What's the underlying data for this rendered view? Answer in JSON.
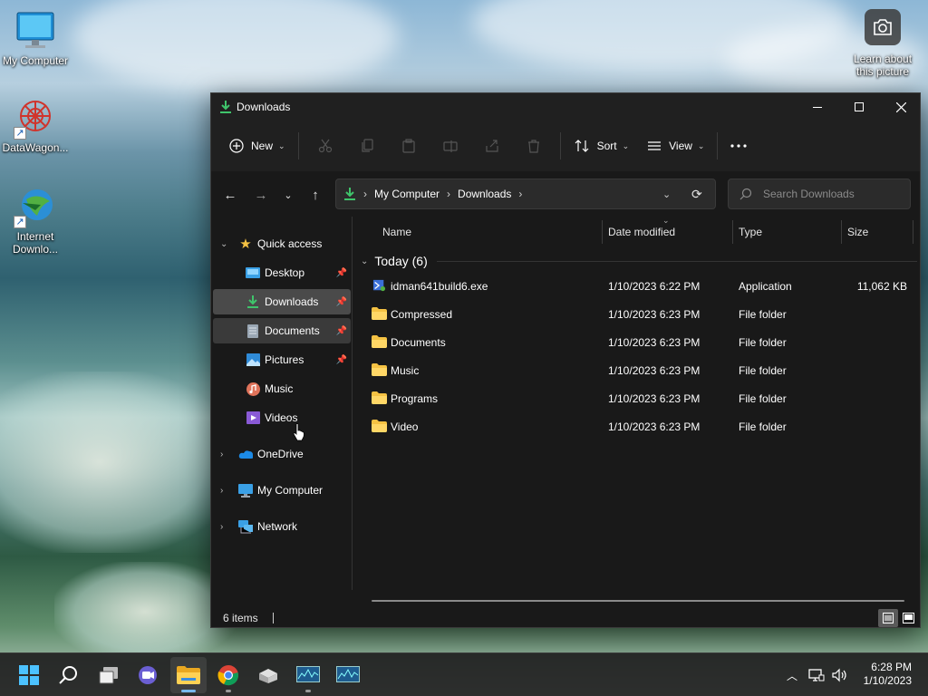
{
  "desktop": {
    "icons": [
      {
        "label": "My Computer"
      },
      {
        "label": "DataWagon..."
      },
      {
        "label": "Internet Downlo..."
      }
    ],
    "learn": "Learn about this picture"
  },
  "window": {
    "title": "Downloads",
    "toolbar": {
      "new_label": "New",
      "sort_label": "Sort",
      "view_label": "View"
    },
    "address": {
      "crumbs": [
        "My Computer",
        "Downloads"
      ]
    },
    "search": {
      "placeholder": "Search Downloads"
    },
    "nav": {
      "quick_access": "Quick access",
      "items": [
        {
          "label": "Desktop"
        },
        {
          "label": "Downloads"
        },
        {
          "label": "Documents"
        },
        {
          "label": "Pictures"
        },
        {
          "label": "Music"
        },
        {
          "label": "Videos"
        }
      ],
      "onedrive": "OneDrive",
      "mycomputer": "My Computer",
      "network": "Network"
    },
    "columns": {
      "name": "Name",
      "date": "Date modified",
      "type": "Type",
      "size": "Size"
    },
    "group": "Today (6)",
    "files": [
      {
        "name": "idman641build6.exe",
        "date": "1/10/2023 6:22 PM",
        "type": "Application",
        "size": "11,062 KB"
      },
      {
        "name": "Compressed",
        "date": "1/10/2023 6:23 PM",
        "type": "File folder",
        "size": ""
      },
      {
        "name": "Documents",
        "date": "1/10/2023 6:23 PM",
        "type": "File folder",
        "size": ""
      },
      {
        "name": "Music",
        "date": "1/10/2023 6:23 PM",
        "type": "File folder",
        "size": ""
      },
      {
        "name": "Programs",
        "date": "1/10/2023 6:23 PM",
        "type": "File folder",
        "size": ""
      },
      {
        "name": "Video",
        "date": "1/10/2023 6:23 PM",
        "type": "File folder",
        "size": ""
      }
    ],
    "status": "6 items"
  },
  "taskbar": {
    "time": "6:28 PM",
    "date": "1/10/2023"
  },
  "colors": {
    "accent": "#4cc2ff",
    "folder": "#f5c243",
    "window_bg": "#191919",
    "selected": "#4a4a4a"
  }
}
